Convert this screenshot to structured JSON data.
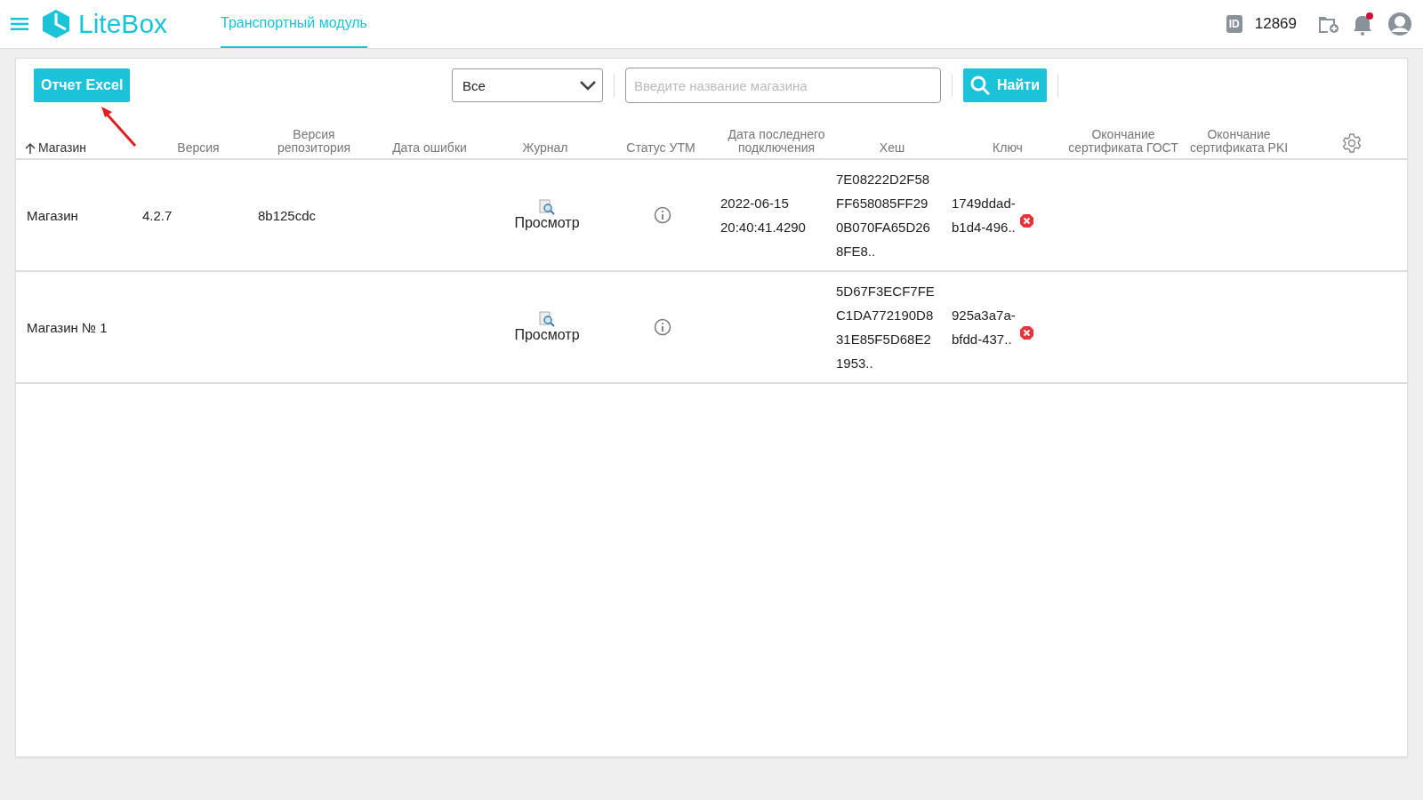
{
  "header": {
    "logo": "LiteBox",
    "tabs": [
      {
        "label": "Транспортный модуль",
        "selected": true
      }
    ],
    "id_label": "ID",
    "id_value": "12869"
  },
  "toolbar": {
    "export_button": "Отчет Excel",
    "filter": {
      "value": "Все"
    },
    "search": {
      "placeholder": "Введите название магазина"
    },
    "search_button": "Найти"
  },
  "table": {
    "columns": [
      {
        "label": "Магазин",
        "sorted": true
      },
      {
        "label": "Версия",
        "sorted": false
      },
      {
        "label": "Версия репозитория",
        "sorted": false
      },
      {
        "label": "Дата ошибки",
        "sorted": false
      },
      {
        "label": "Журнал",
        "sorted": false
      },
      {
        "label": "Статус УТМ",
        "sorted": false
      },
      {
        "label": "Дата последнего подключения",
        "sorted": false
      },
      {
        "label": "Хеш",
        "sorted": false
      },
      {
        "label": "Ключ",
        "sorted": false
      },
      {
        "label": "Окончание сертификата ГОСТ",
        "sorted": false
      },
      {
        "label": "Окончание сертификата PKI",
        "sorted": false
      }
    ],
    "rows": [
      {
        "store": "Магазин",
        "version": "4.2.7",
        "repo_version": "8b125cdc",
        "journal": "Просмотр",
        "last_connection": [
          "2022-06-15",
          "20:40:41.4290"
        ],
        "hash": [
          "7E08222D2F58",
          "FF658085FF29",
          "0B070FA65D26",
          "8FE8.."
        ],
        "key": [
          "1749ddad-",
          "b1d4-496.."
        ]
      },
      {
        "store": "Магазин № 1",
        "version": "",
        "repo_version": "",
        "journal": "Просмотр",
        "last_connection": [],
        "hash": [
          "5D67F3ECF7FE",
          "C1DA772190D8",
          "31E85F5D68E2",
          "1953.."
        ],
        "key": [
          "925a3a7a-",
          "bfdd-437.."
        ]
      }
    ]
  }
}
